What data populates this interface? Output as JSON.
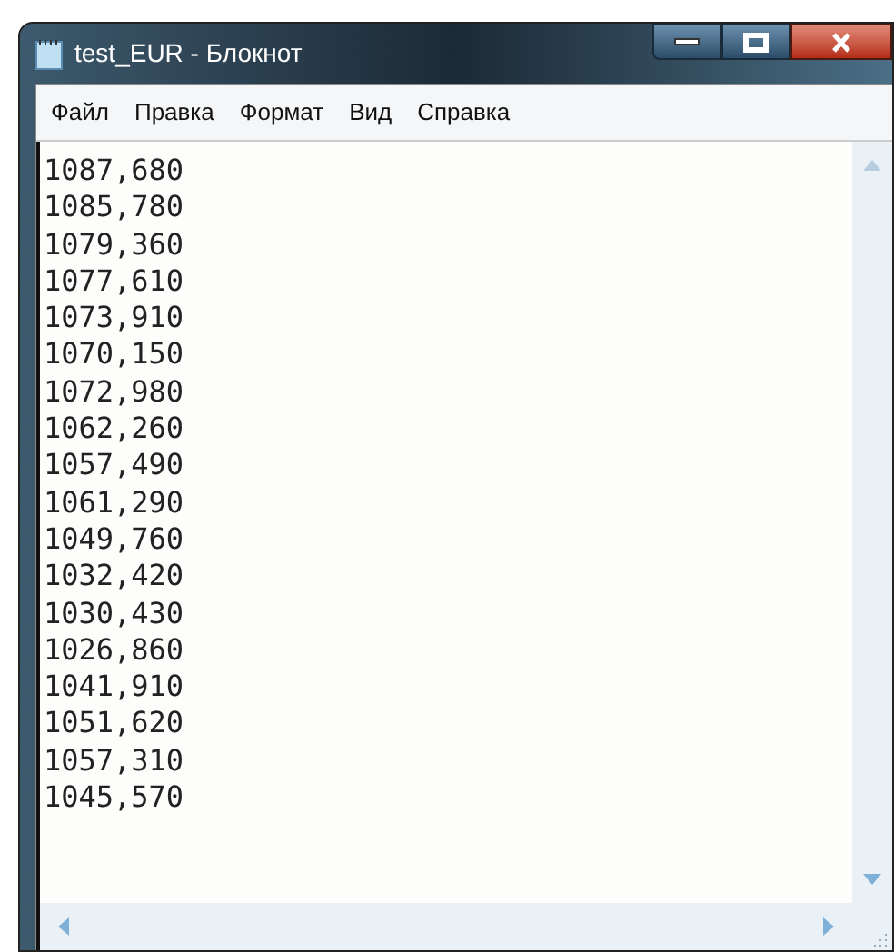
{
  "window": {
    "title": "test_EUR - Блокнот"
  },
  "menu": [
    {
      "label": "Файл"
    },
    {
      "label": "Правка"
    },
    {
      "label": "Формат"
    },
    {
      "label": "Вид"
    },
    {
      "label": "Справка"
    }
  ],
  "lines": [
    "1087,680",
    "1085,780",
    "1079,360",
    "1077,610",
    "1073,910",
    "1070,150",
    "1072,980",
    "1062,260",
    "1057,490",
    "1061,290",
    "1049,760",
    "1032,420",
    "1030,430",
    "1026,860",
    "1041,910",
    "1051,620",
    "1057,310",
    "1045,570"
  ]
}
